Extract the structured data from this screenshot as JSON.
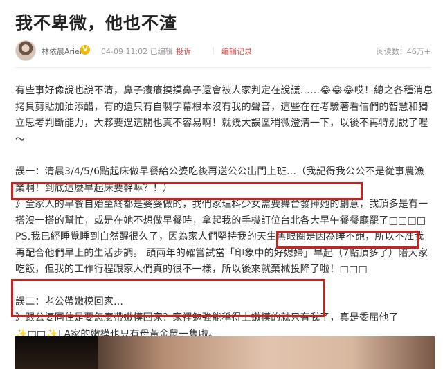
{
  "article": {
    "title": "我不卑微，他也不渣"
  },
  "meta": {
    "author": "林依晨Ariel",
    "badge": "V",
    "date": "04-09 11:02 已编辑",
    "report_label": "投诉",
    "history_label": "编辑记录",
    "reads": "阅读数：46万+"
  },
  "body": {
    "p1": "有些事好像說也說不清，鼻子癢癢摸摸鼻子還會被人家判定在說謊……😂😂😂哎！總之各種消息拷貝剪貼加油添醋，有的還只有自製字幕根本沒有我的聲音，這些在在考驗著看信們的智慧和獨立思考判斷能力，大夥要過這關也真不容易啊！就幾大誤區稍微澄清一下，以後不再特別說了喔～",
    "p2": "誤一：清晨3/4/5/6點起床做早餐給公婆吃後再送公公出門上班…（我記得我公公不是從事農漁業啊！到底這麼早起床要幹嘛？！）",
    "p3": "》全家人的早餐自始至終都是婆婆做的，我們家理科少女需要舞台發揮她的創意，我頂多是有一搭沒一搭的幫忙，或是在她不想做早餐時，拿起我的手機訂位台北各大早午餐餐廳罷了□□□□ PS.我已經睡覺睡到自然醒很久了，因為家人們堅持我的天生黑眼圈是因為睡不飽，所以不准我再配合他們早上的生活步調。 頭兩年的確嘗試當「印象中的好媳婦」早起（7點頂多了）陪大家吃飯，但我的工作行程跟家人們真的很不一樣，所以後來就棄械投降了啦！□□□",
    "p4": "誤二：老公帶嫩模回家…",
    "p5": "》跟公婆同住是要怎麼帶嫩模回家？家裡勉強能稱得上嫩模的就只有我了，真是委屈他了✨□□✨LA家的嫩模也只有母黃金鼠一隻啦。"
  }
}
